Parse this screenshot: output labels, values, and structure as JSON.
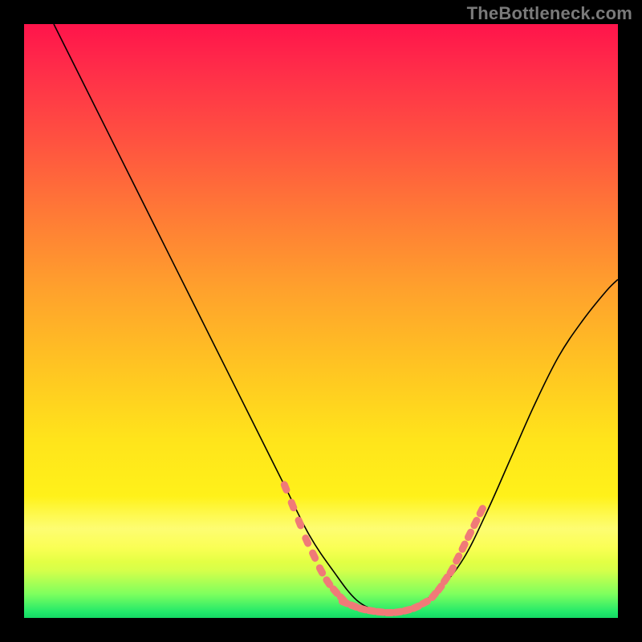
{
  "watermark": "TheBottleneck.com",
  "chart_data": {
    "type": "line",
    "title": "",
    "xlabel": "",
    "ylabel": "",
    "xlim": [
      0,
      100
    ],
    "ylim": [
      0,
      100
    ],
    "grid": false,
    "legend": false,
    "series": [
      {
        "name": "curve",
        "x": [
          5,
          8,
          12,
          16,
          20,
          24,
          28,
          32,
          36,
          40,
          44,
          48,
          52,
          56,
          60,
          62,
          66,
          70,
          74,
          78,
          82,
          86,
          90,
          94,
          98,
          100
        ],
        "y": [
          100,
          94,
          86,
          78,
          70,
          62,
          54,
          46,
          38,
          30,
          22,
          14,
          8,
          3,
          1,
          1,
          2,
          5,
          10,
          18,
          27,
          36,
          44,
          50,
          55,
          57
        ]
      }
    ],
    "markers_left": {
      "name": "highlight-left",
      "x": [
        44,
        45.2,
        46.4,
        47.6,
        48.8,
        50,
        51.2,
        52.4,
        53.6
      ],
      "y": [
        22,
        19,
        16,
        13,
        10.5,
        8,
        6,
        4.5,
        3.2
      ]
    },
    "markers_bottom": {
      "name": "highlight-bottom",
      "x": [
        54,
        55.5,
        57,
        58.5,
        60,
        61.5,
        63,
        64.5,
        66,
        67.5
      ],
      "y": [
        2.6,
        2.0,
        1.5,
        1.2,
        1.0,
        0.9,
        1.0,
        1.3,
        1.8,
        2.6
      ]
    },
    "markers_right": {
      "name": "highlight-right",
      "x": [
        69,
        70,
        71,
        72,
        73,
        74,
        75,
        76,
        77
      ],
      "y": [
        3.8,
        5,
        6.5,
        8,
        10,
        12,
        14,
        16,
        18
      ]
    },
    "gradient_stops": [
      {
        "pos": 0,
        "color": "#ff144b"
      },
      {
        "pos": 20,
        "color": "#ff5340"
      },
      {
        "pos": 45,
        "color": "#ffa22c"
      },
      {
        "pos": 70,
        "color": "#ffe41b"
      },
      {
        "pos": 88,
        "color": "#f9ff3a"
      },
      {
        "pos": 96,
        "color": "#7dff5e"
      },
      {
        "pos": 100,
        "color": "#14d964"
      }
    ]
  }
}
